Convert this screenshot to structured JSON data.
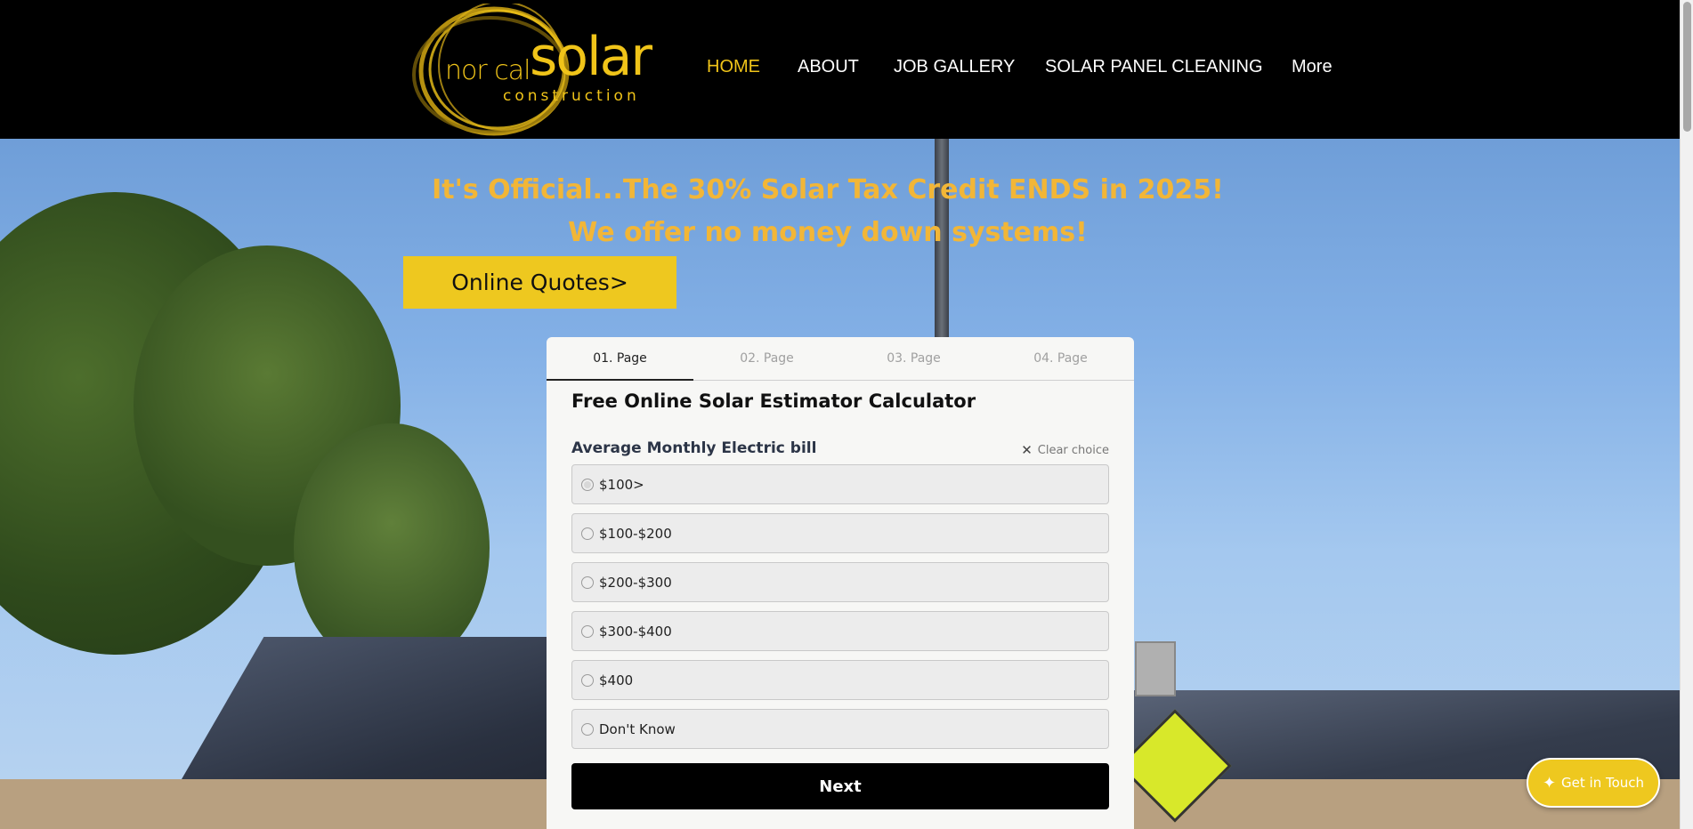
{
  "header": {
    "logo": {
      "norcal": "nor cal",
      "solar": "solar",
      "construction": "construction"
    },
    "nav": [
      {
        "label": "HOME",
        "active": true
      },
      {
        "label": "ABOUT",
        "active": false
      },
      {
        "label": "JOB GALLERY",
        "active": false
      },
      {
        "label": "SOLAR PANEL CLEANING",
        "active": false
      },
      {
        "label": "More",
        "active": false
      }
    ]
  },
  "hero": {
    "headline1": "It's Official...The 30% Solar Tax Credit ENDS in 2025!",
    "headline2": "We offer no money down systems!",
    "quotes_button": "Online Quotes>"
  },
  "form": {
    "tabs": [
      "01. Page",
      "02. Page",
      "03. Page",
      "04. Page"
    ],
    "active_tab": 0,
    "title": "Free Online Solar Estimator Calculator",
    "question": "Average Monthly Electric bill",
    "clear_choice": "Clear choice",
    "options": [
      "$100>",
      "$100-$200",
      "$200-$300",
      "$300-$400",
      "$400",
      "Don't Know"
    ],
    "next_button": "Next"
  },
  "floating": {
    "get_in_touch": "Get in Touch"
  },
  "colors": {
    "accent": "#f0c419",
    "headline": "#f2b637",
    "button_yellow": "#eec81f"
  }
}
